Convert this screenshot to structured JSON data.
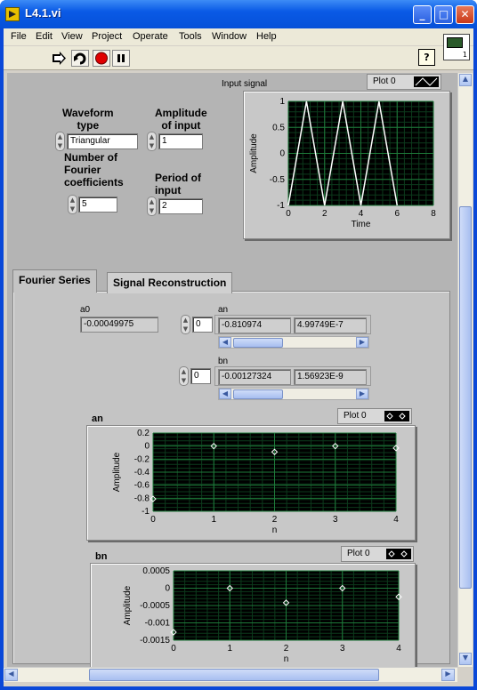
{
  "window": {
    "title": "L4.1.vi"
  },
  "menu": [
    "File",
    "Edit",
    "View",
    "Project",
    "Operate",
    "Tools",
    "Window",
    "Help"
  ],
  "vi_icon_number": "1",
  "help_label": "?",
  "controls": {
    "waveform_type_label": "Waveform\ntype",
    "waveform_type_value": "Triangular",
    "amplitude_label": "Amplitude\nof input",
    "amplitude_value": "1",
    "fourier_label": "Number of\nFourier\ncoefficients",
    "fourier_value": "5",
    "period_label": "Period of\ninput",
    "period_value": "2"
  },
  "input_graph": {
    "title": "Input signal",
    "legend": "Plot 0",
    "xlabel": "Time",
    "ylabel": "Amplitude"
  },
  "tabs": [
    {
      "label": "Fourier Series"
    },
    {
      "label": "Signal Reconstruction"
    }
  ],
  "a0": {
    "label": "a0",
    "value": "-0.00049975"
  },
  "an_array": {
    "label": "an",
    "index": "0",
    "values": [
      "-0.810974",
      "4.99749E-7"
    ]
  },
  "bn_array": {
    "label": "bn",
    "index": "0",
    "values": [
      "-0.00127324",
      "1.56923E-9"
    ]
  },
  "an_graph": {
    "title": "an",
    "legend": "Plot 0",
    "xlabel": "n",
    "ylabel": "Amplitude"
  },
  "bn_graph": {
    "title": "bn",
    "legend": "Plot 0",
    "xlabel": "n",
    "ylabel": "Amplitude"
  },
  "chart_data": [
    {
      "type": "line",
      "title": "Input signal",
      "xlabel": "Time",
      "ylabel": "Amplitude",
      "xlim": [
        0,
        8
      ],
      "ylim": [
        -1,
        1
      ],
      "xticks": [
        "0",
        "2",
        "4",
        "6",
        "8"
      ],
      "yticks": [
        "1",
        "0.5",
        "0",
        "-0.5",
        "-1"
      ],
      "series": [
        {
          "name": "Plot 0",
          "x": [
            0,
            1,
            2,
            3,
            4,
            5,
            6
          ],
          "y": [
            -1,
            1,
            -1,
            1,
            -1,
            1,
            -1
          ]
        }
      ],
      "grid": true,
      "line_color": "#ffffff",
      "grid_color": "#1e7a3a"
    },
    {
      "type": "scatter",
      "title": "an",
      "xlabel": "n",
      "ylabel": "Amplitude",
      "xlim": [
        0,
        4
      ],
      "ylim": [
        -1,
        0.2
      ],
      "xticks": [
        "0",
        "1",
        "2",
        "3",
        "4"
      ],
      "yticks": [
        "0.2",
        "0",
        "-0.2",
        "-0.4",
        "-0.6",
        "-0.8",
        "-1"
      ],
      "series": [
        {
          "name": "Plot 0",
          "x": [
            0,
            1,
            2,
            3,
            4
          ],
          "y": [
            -0.81,
            0,
            -0.09,
            0,
            -0.03
          ]
        }
      ],
      "grid": true
    },
    {
      "type": "scatter",
      "title": "bn",
      "xlabel": "n",
      "ylabel": "Amplitude",
      "xlim": [
        0,
        4
      ],
      "ylim": [
        -0.0015,
        0.0005
      ],
      "xticks": [
        "0",
        "1",
        "2",
        "3",
        "4"
      ],
      "yticks": [
        "0.0005",
        "0",
        "-0.0005",
        "-0.001",
        "-0.0015"
      ],
      "series": [
        {
          "name": "Plot 0",
          "x": [
            0,
            1,
            2,
            3,
            4
          ],
          "y": [
            -0.00127,
            0,
            -0.00042,
            0,
            -0.00025
          ]
        }
      ],
      "grid": true
    }
  ]
}
